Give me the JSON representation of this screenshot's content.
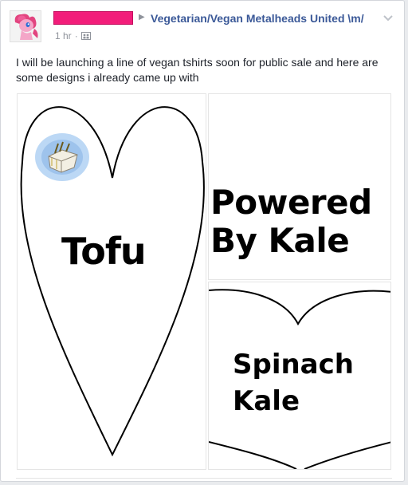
{
  "post": {
    "group_name": "Vegetarian/Vegan Metalheads United \\m/",
    "timestamp": "1 hr",
    "separator": "·",
    "text": "I will be launching a line of vegan tshirts soon for public sale and here are some designs i already came up with"
  },
  "photos": {
    "left": {
      "caption": "Tofu"
    },
    "top_right": {
      "caption_line1": "Powered",
      "caption_line2": "By Kale"
    },
    "bottom_right": {
      "caption_line1": "Spinach",
      "caption_line2": "Kale"
    }
  },
  "colors": {
    "link": "#3b5998",
    "redaction": "#f21d7a",
    "meta": "#90949c"
  },
  "icons": [
    "pony-avatar",
    "group-icon",
    "chevron-down-icon",
    "tofu-icon"
  ]
}
